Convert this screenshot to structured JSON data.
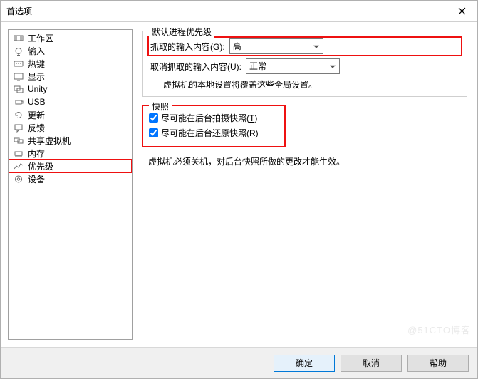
{
  "window": {
    "title": "首选项"
  },
  "sidebar": {
    "items": [
      {
        "label": "工作区"
      },
      {
        "label": "输入"
      },
      {
        "label": "热键"
      },
      {
        "label": "显示"
      },
      {
        "label": "Unity"
      },
      {
        "label": "USB"
      },
      {
        "label": "更新"
      },
      {
        "label": "反馈"
      },
      {
        "label": "共享虚拟机"
      },
      {
        "label": "内存"
      },
      {
        "label": "优先级",
        "highlighted": true,
        "selected": true
      },
      {
        "label": "设备"
      }
    ]
  },
  "content": {
    "group_priority": {
      "legend": "默认进程优先级",
      "row_grabbed": {
        "label_pre": "抓取的输入内容(",
        "hotkey": "G",
        "label_post": "):",
        "value": "高",
        "highlighted": true,
        "select_width": 132
      },
      "row_ungrabbed": {
        "label_pre": "取消抓取的输入内容(",
        "hotkey": "U",
        "label_post": "):",
        "value": "正常",
        "select_width": 132
      },
      "note": "虚拟机的本地设置将覆盖这些全局设置。"
    },
    "group_snapshot": {
      "legend": "快照",
      "highlighted": true,
      "cb_take": {
        "label_pre": "尽可能在后台拍摄快照(",
        "hotkey": "T",
        "label_post": ")",
        "checked": true
      },
      "cb_restore": {
        "label_pre": "尽可能在后台还原快照(",
        "hotkey": "R",
        "label_post": ")",
        "checked": true
      },
      "note": "虚拟机必须关机，对后台快照所做的更改才能生效。"
    }
  },
  "footer": {
    "ok": "确定",
    "cancel": "取消",
    "help": "帮助"
  },
  "watermark": "@51CTO博客"
}
